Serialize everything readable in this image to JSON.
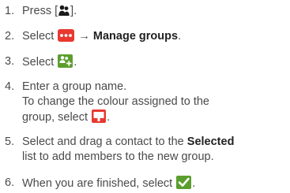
{
  "steps": [
    {
      "num": "1.",
      "before": "Press [",
      "after": "]."
    },
    {
      "num": "2.",
      "before": "Select",
      "arrow": "→",
      "bold": "Manage groups",
      "after": "."
    },
    {
      "num": "3.",
      "before": "Select",
      "after": "."
    },
    {
      "num": "4.",
      "line1": "Enter a group name.",
      "line2": "To change the colour assigned to the",
      "line3_before": "group, select",
      "line3_after": "."
    },
    {
      "num": "5.",
      "line1_before": "Select and drag a contact to the",
      "line1_bold": "Selected",
      "line2": "list to add members to the new group."
    },
    {
      "num": "6.",
      "before": "When you are finished, select",
      "after": "."
    }
  ],
  "icons": {
    "contacts": "contacts-icon",
    "more": "more-options-icon",
    "add_group": "add-group-icon",
    "colour": "colour-icon",
    "done": "checkmark-icon"
  },
  "colors": {
    "text": "#4a4a4a",
    "icon_red": "#e8382f",
    "icon_green": "#5c9e2e",
    "icon_dark": "#1a1a1a"
  }
}
